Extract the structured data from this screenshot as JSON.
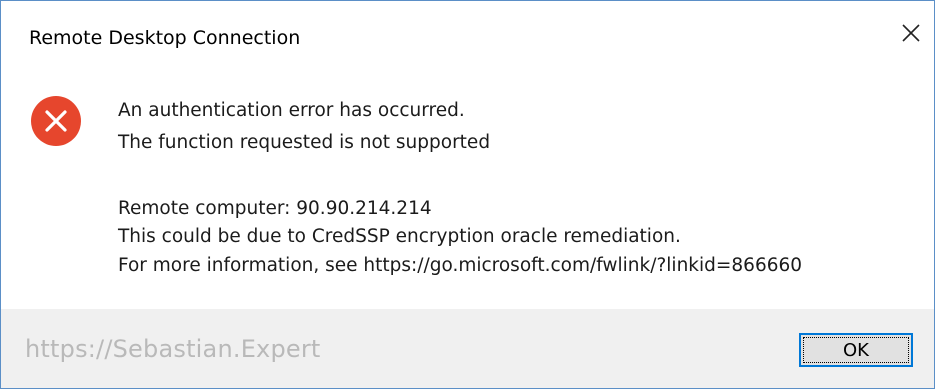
{
  "dialog": {
    "title": "Remote Desktop Connection",
    "icon": "error-icon",
    "close_icon": "close-icon",
    "message_lines": [
      "An authentication error has occurred.",
      "The function requested is not supported",
      "Remote computer: 90.90.214.214",
      "This could be due to CredSSP encryption oracle remediation.",
      "For more information, see https://go.microsoft.com/fwlink/?linkid=866660"
    ],
    "ok_label": "OK",
    "watermark": "https://Sebastian.Expert"
  },
  "colors": {
    "error_red": "#e6462d",
    "accent_blue": "#0078d7",
    "footer_bg": "#f0f0f0",
    "border": "#5b8fc7"
  }
}
